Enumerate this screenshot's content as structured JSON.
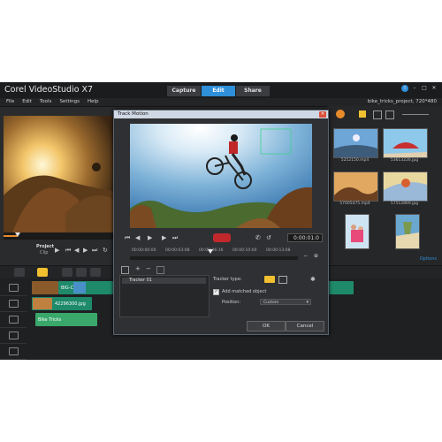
{
  "app": {
    "title": "Corel VideoStudio X7",
    "tabs": [
      {
        "label": "Capture"
      },
      {
        "label": "Edit"
      },
      {
        "label": "Share"
      }
    ],
    "active_tab": "Edit",
    "project_name": "bike_tricks_project, 720*480",
    "accent_color": "#2f8fd8"
  },
  "menu": {
    "items": [
      "File",
      "Edit",
      "Tools",
      "Settings",
      "Help"
    ]
  },
  "player": {
    "project_label": "Project",
    "clip_label": "Clip",
    "progress": 0.13
  },
  "library": {
    "thumbnails": [
      {
        "caption": "5252150.mp4"
      },
      {
        "caption": "53613226.jpg"
      },
      {
        "caption": "57005475.mp4"
      },
      {
        "caption": "57512869.jpg"
      }
    ],
    "options_label": "Options"
  },
  "timeline": {
    "clips": [
      {
        "label": "BIG-C"
      },
      {
        "label": "42296300.jpg"
      },
      {
        "label": "Bike Tricks"
      }
    ]
  },
  "dialog": {
    "title": "Track Motion",
    "close_icon": "close-icon",
    "timecode": "0:00:01:0",
    "ruler_labels": [
      "00:00:00:00",
      "00:00:03:08",
      "00:00:06:16",
      "00:00:10:00",
      "00:00:13:08"
    ],
    "tracker_item": "Tracker 01",
    "tracker_type_label": "Tracker type:",
    "add_matched_label": "Add matched object",
    "add_matched_checked": true,
    "position_label": "Position:",
    "position_value": "Custom",
    "ok_label": "OK",
    "cancel_label": "Cancel"
  }
}
